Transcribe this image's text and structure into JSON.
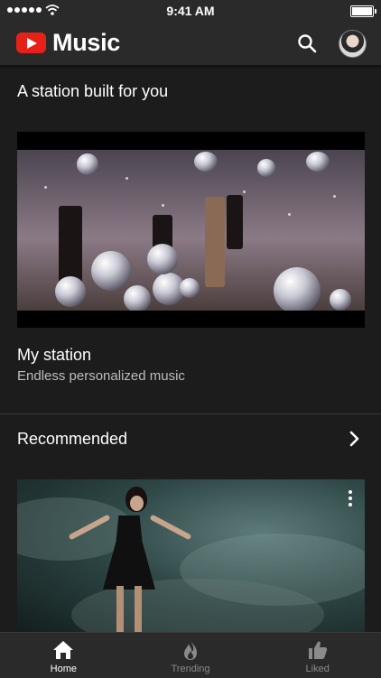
{
  "status_bar": {
    "time": "9:41 AM",
    "signal_icon": "signal-dots-icon",
    "wifi_icon": "wifi-icon",
    "battery_icon": "battery-icon"
  },
  "header": {
    "logo_icon": "youtube-play-icon",
    "title": "Music",
    "search_icon": "search-icon",
    "avatar_icon": "profile-avatar"
  },
  "station_section": {
    "heading": "A station built for you",
    "card_title": "My station",
    "card_subtitle": "Endless personalized music"
  },
  "recommended": {
    "title": "Recommended",
    "chevron_icon": "chevron-right-icon",
    "more_icon": "more-vertical-icon"
  },
  "bottom_nav": [
    {
      "label": "Home",
      "icon": "home-icon",
      "active": true
    },
    {
      "label": "Trending",
      "icon": "flame-icon",
      "active": false
    },
    {
      "label": "Liked",
      "icon": "thumbs-up-icon",
      "active": false
    }
  ],
  "colors": {
    "background": "#1c1c1c",
    "header": "#2a2a2a",
    "brand_red": "#e62117",
    "inactive": "#8a8a8a"
  }
}
